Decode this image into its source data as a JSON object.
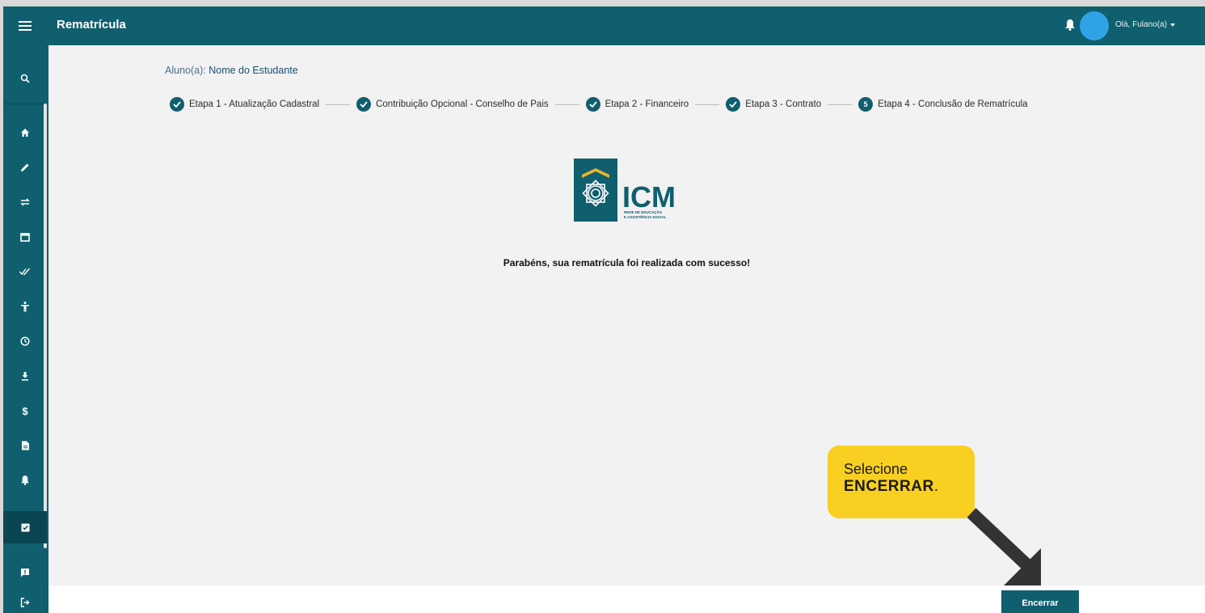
{
  "header": {
    "title": "Rematrícula",
    "user_greeting": "Olá, Fulano(a)"
  },
  "sidebar": {
    "items": [
      {
        "icon": "search-icon"
      },
      {
        "icon": "home-icon"
      },
      {
        "icon": "pencil-icon"
      },
      {
        "icon": "swap-icon"
      },
      {
        "icon": "calendar-icon"
      },
      {
        "icon": "double-check-icon"
      },
      {
        "icon": "accessibility-icon"
      },
      {
        "icon": "clock-icon"
      },
      {
        "icon": "download-icon"
      },
      {
        "icon": "dollar-icon"
      },
      {
        "icon": "document-icon"
      },
      {
        "icon": "bell-icon"
      },
      {
        "icon": "clipboard-check-icon",
        "active": true
      },
      {
        "icon": "feedback-icon"
      },
      {
        "icon": "logout-icon"
      }
    ]
  },
  "student": {
    "label": "Aluno(a):",
    "name": "Nome do Estudante"
  },
  "steps": [
    {
      "label": "Etapa 1 - Atualização Cadastral",
      "status": "done"
    },
    {
      "label": "Contribuição Opcional - Conselho de Pais",
      "status": "done"
    },
    {
      "label": "Etapa 2 - Financeiro",
      "status": "done"
    },
    {
      "label": "Etapa 3 - Contrato",
      "status": "done"
    },
    {
      "label": "Etapa 4 - Conclusão de Rematrícula",
      "status": "current",
      "number": "5"
    }
  ],
  "logo": {
    "text": "ICM",
    "subtitle_line1": "REDE DE EDUCAÇÃO",
    "subtitle_line2": "E ASSISTÊNCIA SOCIAL"
  },
  "message": "Parabéns, sua rematrícula foi realizada com sucesso!",
  "footer": {
    "end_button": "Encerrar"
  },
  "callout": {
    "line1": "Selecione",
    "line2": "ENCERRAR",
    "line2_suffix": "."
  },
  "colors": {
    "primary": "#0f5f6e",
    "accent_avatar": "#2fa3e6",
    "callout": "#f9cf21",
    "logo_gold": "#e9b62a"
  }
}
